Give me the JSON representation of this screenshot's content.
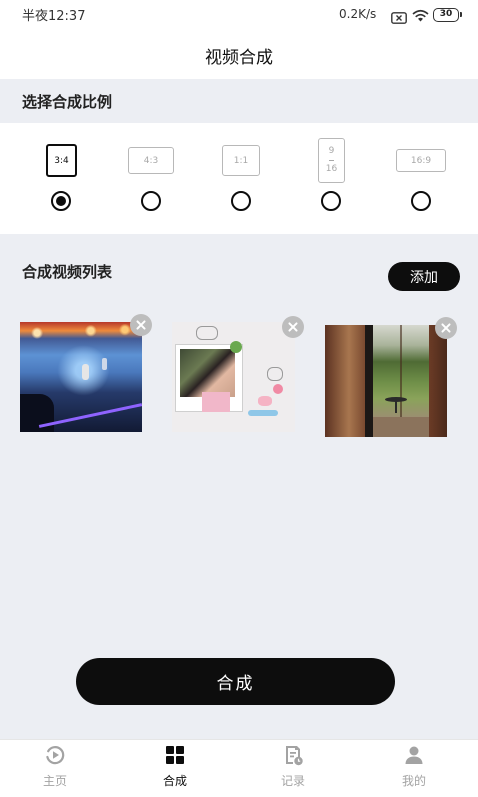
{
  "status_bar": {
    "time": "半夜12:37",
    "network_speed": "0.2K/s",
    "battery_level": "30",
    "icons": [
      "sim-off-icon",
      "wifi-icon",
      "battery-icon"
    ]
  },
  "header": {
    "title": "视频合成"
  },
  "ratio_section": {
    "title": "选择合成比例",
    "selected_index": 0,
    "options": [
      {
        "label": "3:4"
      },
      {
        "label": "4:3"
      },
      {
        "label": "1:1"
      },
      {
        "label_top": "9",
        "label_bottom": "16"
      },
      {
        "label": "16:9"
      }
    ]
  },
  "video_list": {
    "title": "合成视频列表",
    "add_label": "添加",
    "remove_icon": "close-icon"
  },
  "compose_button": {
    "label": "合成"
  },
  "bottom_nav": {
    "active_index": 1,
    "items": [
      {
        "label": "主页",
        "icon": "play-circle-icon"
      },
      {
        "label": "合成",
        "icon": "grid-icon"
      },
      {
        "label": "记录",
        "icon": "record-icon"
      },
      {
        "label": "我的",
        "icon": "user-icon"
      }
    ]
  },
  "colors": {
    "accent": "#0d0d0d",
    "inactive": "#a3a3a3",
    "section_background": "#eceef3",
    "remove_badge": "#bdbdbd"
  }
}
